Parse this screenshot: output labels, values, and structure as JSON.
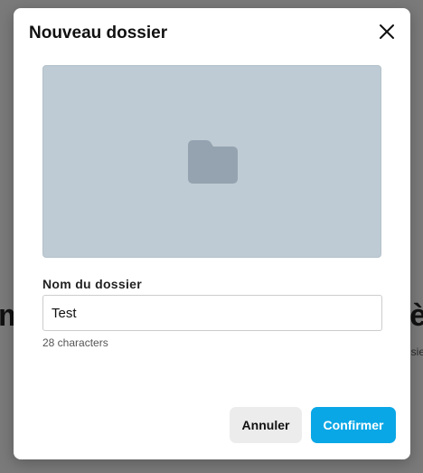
{
  "background": {
    "left_fragment": "m",
    "right_fragment": "è",
    "right_small_fragment": "sie"
  },
  "dialog": {
    "title": "Nouveau dossier",
    "close_icon": "close-icon",
    "preview": {
      "icon": "folder-icon",
      "background_color": "#bfcbd4",
      "icon_color": "#94a3af"
    },
    "field": {
      "label": "Nom du dossier",
      "value": "Test",
      "char_count": "28 characters"
    },
    "buttons": {
      "cancel_label": "Annuler",
      "confirm_label": "Confirmer"
    },
    "colors": {
      "accent": "#0aa7e6",
      "cancel_bg": "#ececec"
    }
  }
}
